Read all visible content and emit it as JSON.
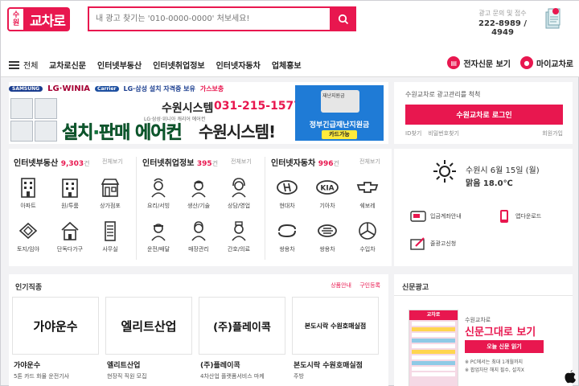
{
  "header": {
    "logo_badge_line1": "수",
    "logo_badge_line2": "원",
    "logo_text": "교차로",
    "search_placeholder": "내 광고 찾기는 '010-0000-0000' 처보세요!",
    "ad_inquiry_label": "광고 문의 및 접수",
    "ad_inquiry_number": "222-8989 / 4949"
  },
  "nav": {
    "all_label": "전체",
    "items": [
      "교차로신문",
      "인터넷부동산",
      "인터넷취업정보",
      "인터넷자동차",
      "업체홍보"
    ],
    "e_paper": "전자신문 보기",
    "my_page": "마이교차로"
  },
  "banner": {
    "brands": [
      "SAMSUNG",
      "LG·WINIA",
      "Carrier",
      "LG·삼성 설치 자격증 보유",
      "가스보충"
    ],
    "company": "수원시스템",
    "phone": "031-215-1577",
    "subline": "LG·삼성·위니아 캐리어 에어컨",
    "slogan": "설치·판매 에어컨",
    "brand_big": "수원시스템!",
    "relief_card_label": "재난지원금",
    "relief_title": "정부긴급재난지원금",
    "relief_card_ok": "카드가능"
  },
  "login": {
    "text": "수원교차로 광고관리를 척척",
    "button": "수원교차로 로그인",
    "find_id": "ID찾기",
    "find_pw": "비밀번호찾기",
    "join": "회원가입"
  },
  "categories": [
    {
      "title": "인터넷부동산",
      "count": "9,303",
      "unit": "건",
      "more": "전체보기",
      "items": [
        "아파트",
        "원/투룸",
        "상가점포",
        "토지/임야",
        "단독다가구",
        "사무실"
      ]
    },
    {
      "title": "인터넷취업정보",
      "count": "395",
      "unit": "건",
      "more": "전체보기",
      "items": [
        "요리/서빙",
        "생산/기술",
        "상담/영업",
        "운전/배달",
        "매장관리",
        "간호/의료"
      ]
    },
    {
      "title": "인터넷자동차",
      "count": "996",
      "unit": "건",
      "more": "전체보기",
      "items": [
        "현대차",
        "기아차",
        "쉐보레",
        "쌍용차",
        "쌍용차",
        "수입차"
      ]
    }
  ],
  "weather": {
    "date": "수원시 6월 15일 (월)",
    "condition": "맑음",
    "temp": "18.0℃",
    "links": [
      "입금계좌안내",
      "앱다운로드",
      "줄광고신청"
    ]
  },
  "jobs": {
    "title": "인기직종",
    "link_product": "상품안내",
    "link_register": "구인등록",
    "cards": [
      {
        "logo": "가야운수",
        "name": "가야운수",
        "desc": "5톤 카드 화물 운전기사"
      },
      {
        "logo": "엘리트산업",
        "name": "엘리트산업",
        "desc": "현장직 직원 모집"
      },
      {
        "logo": "(주)플레이콕",
        "name": "(주)플레이콕",
        "desc": "4차산업 플랫폼서비스 마케"
      },
      {
        "logo": "본도시락 수원호매실점",
        "name": "본도시락 수원호매실점",
        "desc": "주방"
      }
    ]
  },
  "paper": {
    "title": "신문광고",
    "thumb_head": "교차로",
    "small": "수원교차로",
    "big": "신문그대로 보기",
    "button": "오늘 신문 읽기",
    "notes": [
      "※ PC에서는 최대 1개월까지",
      "※ 팝업차단 해지 필수, 설치X"
    ]
  },
  "colors": {
    "brand": "#e8174f",
    "slogan_green": "#0e7a3c",
    "relief_blue": "#1f7bd6"
  }
}
